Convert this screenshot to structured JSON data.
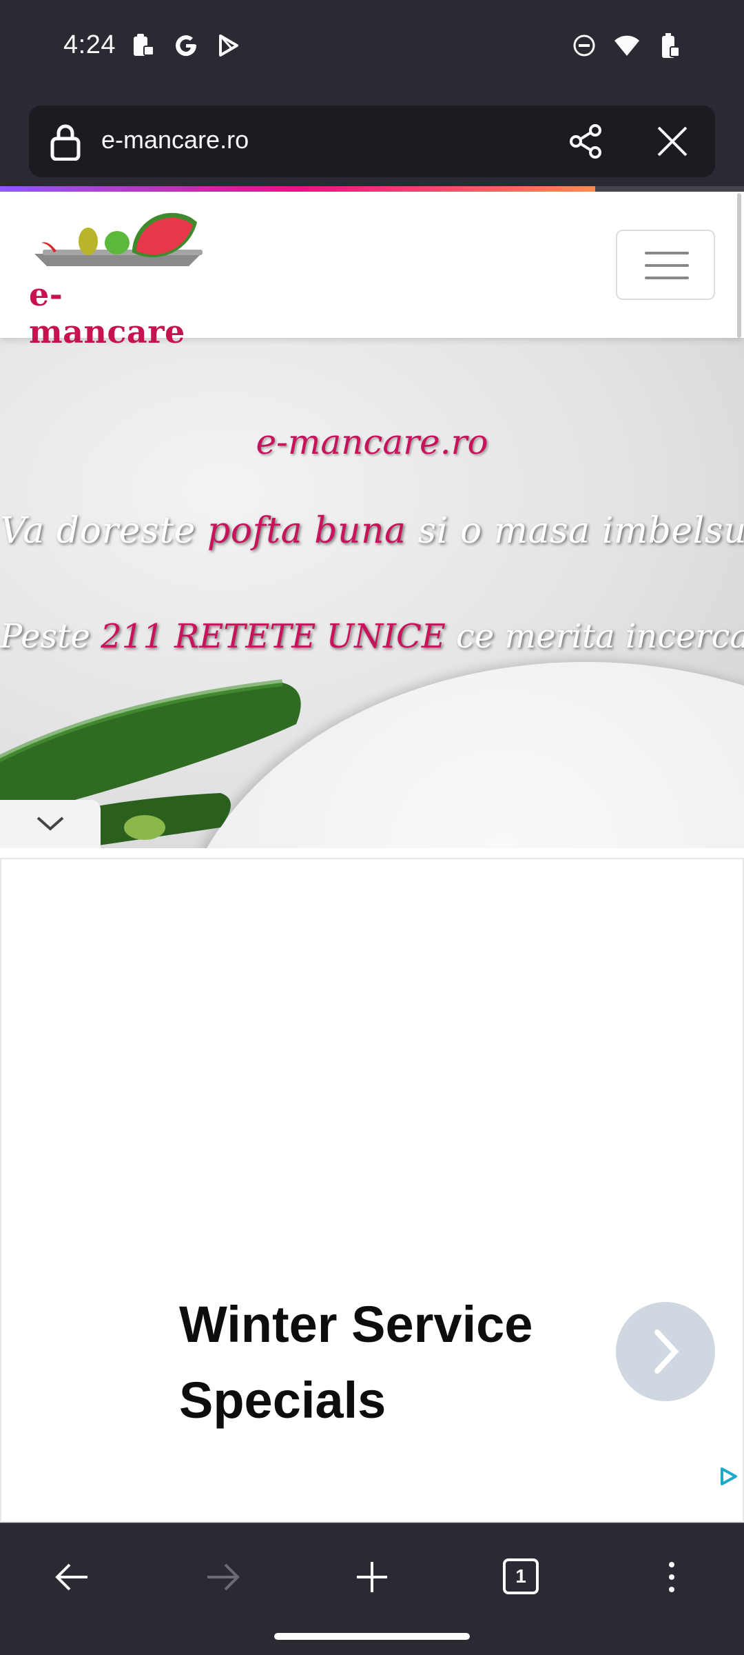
{
  "status_bar": {
    "time": "4:24",
    "left_icons": [
      "clipboard-lock-icon",
      "google-icon",
      "play-store-icon"
    ],
    "right_icons": [
      "do-not-disturb-icon",
      "wifi-icon",
      "battery-charging-icon"
    ]
  },
  "browser": {
    "url": "e-mancare.ro",
    "load_progress_percent": 80,
    "tab_count": "1"
  },
  "site": {
    "logo_text": "e-mancare",
    "hero": {
      "title": "e-mancare.ro",
      "line1_a": "Va doreste ",
      "line1_pink": "pofta buna",
      "line1_b": " si o masa imbelsugata",
      "line2_a": "Peste ",
      "line2_pink": "211 RETETE UNICE",
      "line2_b": " ce merita incercate"
    }
  },
  "ad": {
    "title": "Winter Service Specials"
  },
  "colors": {
    "brand_pink": "#c8125a",
    "browser_bg": "#2b2a33"
  }
}
